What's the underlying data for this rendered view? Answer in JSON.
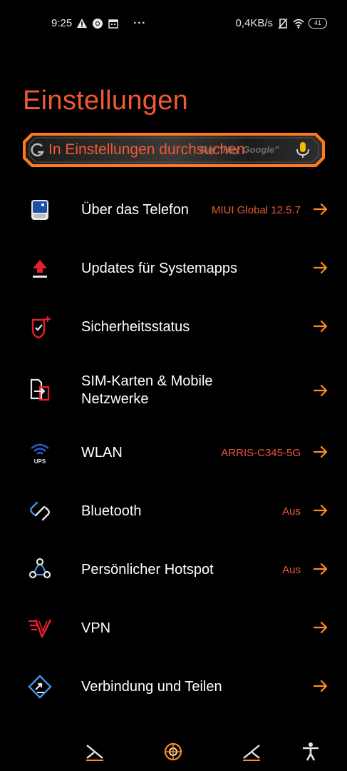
{
  "status_bar": {
    "time": "9:25",
    "network_speed": "0,4KB/s",
    "battery_level": "41",
    "icons_left": [
      "warning-icon",
      "chrome-icon",
      "calendar-icon",
      "more-dots"
    ],
    "icons_right": [
      "no-sim-icon",
      "wifi-icon",
      "battery-icon"
    ]
  },
  "page": {
    "title": "Einstellungen"
  },
  "search": {
    "placeholder": "In Einstellungen durchsuchen",
    "hint": "Say \"Hey Google\""
  },
  "settings": [
    {
      "label": "Über das Telefon",
      "value": "MIUI Global 12.5.7",
      "icon": "phone-info-icon"
    },
    {
      "label": "Updates für Systemapps",
      "value": "",
      "icon": "update-arrow-icon"
    },
    {
      "label": "Sicherheitsstatus",
      "value": "",
      "icon": "shield-check-icon"
    },
    {
      "label": "SIM-Karten & Mobile Netzwerke",
      "value": "",
      "icon": "sim-card-icon"
    },
    {
      "label": "WLAN",
      "value": "ARRIS-C345-5G",
      "icon": "wifi-ups-icon"
    },
    {
      "label": "Bluetooth",
      "value": "Aus",
      "icon": "bluetooth-icon"
    },
    {
      "label": "Persönlicher Hotspot",
      "value": "Aus",
      "icon": "hotspot-icon"
    },
    {
      "label": "VPN",
      "value": "",
      "icon": "vpn-icon"
    },
    {
      "label": "Verbindung und Teilen",
      "value": "",
      "icon": "connection-share-icon"
    }
  ],
  "colors": {
    "accent": "#f05a32",
    "value_text": "#e8573a",
    "chevron": "#ff8c1a",
    "background": "#000000"
  },
  "bottom_nav": [
    "swords-left-icon",
    "emblem-icon",
    "swords-right-icon",
    "accessibility-icon"
  ]
}
